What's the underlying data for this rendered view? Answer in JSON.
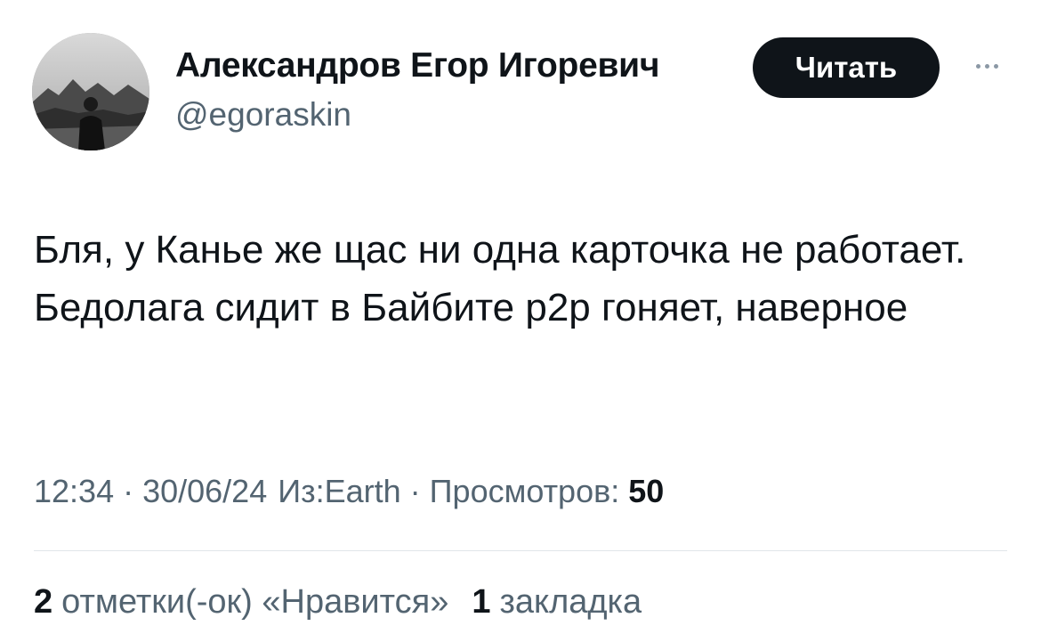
{
  "author": {
    "name": "Александров Егор Игоревич",
    "handle": "@egoraskin"
  },
  "follow_label": "Читать",
  "more_icon": "more-horizontal-icon",
  "tweet": {
    "text": "Бля, у Канье же щас ни одна карточка не работает. Бедолага сидит в Байбите р2р гоняет, наверное"
  },
  "meta": {
    "time": "12:34",
    "separator": "·",
    "date": "30/06/24",
    "source": "Из:Earth",
    "views_label": "Просмотров:",
    "views_count": "50"
  },
  "stats": {
    "likes_count": "2",
    "likes_label": "отметки(-ок) «Нравится»",
    "bookmarks_count": "1",
    "bookmarks_label": "закладка"
  }
}
